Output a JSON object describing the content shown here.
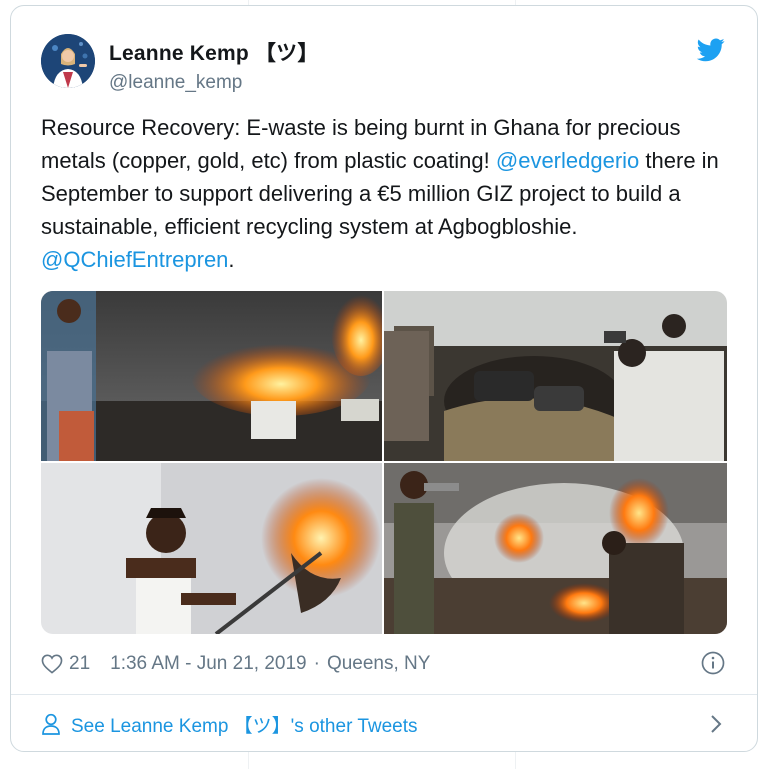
{
  "author": {
    "display_name": "Leanne Kemp 【ツ】",
    "handle": "@leanne_kemp"
  },
  "tweet": {
    "text_part1": "Resource Recovery:  E-waste is being burnt in Ghana for precious metals (copper, gold, etc) from plastic coating! ",
    "mention1": "@everledgerio",
    "text_part2": " there in September to support delivering a €5 million GIZ project to build a sustainable, efficient recycling system at Agbogbloshie. ",
    "mention2": "@QChiefEntrepren",
    "text_part3": "."
  },
  "meta": {
    "like_count": "21",
    "time": "1:36 AM - Jun 21, 2019",
    "separator": "·",
    "location": "Queens, NY"
  },
  "footer": {
    "link_text": "See Leanne Kemp 【ツ】's other Tweets"
  },
  "icons": {
    "brand": "twitter-bird-icon",
    "like": "heart-icon",
    "info": "info-icon",
    "person": "person-icon",
    "chevron": "chevron-right-icon"
  },
  "colors": {
    "link": "#1b95e0",
    "muted": "#657786",
    "text": "#14171a",
    "border": "#cfd9de"
  }
}
